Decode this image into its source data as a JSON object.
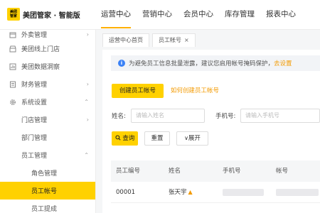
{
  "app": {
    "logo_badge_top": "美团",
    "logo_badge_bottom": "管家",
    "title": "美团管家 · 智能版"
  },
  "nav": [
    "运营中心",
    "营销中心",
    "会员中心",
    "库存管理",
    "报表中心"
  ],
  "sidebar": {
    "items": [
      {
        "label": "外卖管理",
        "icon": "takeout-icon"
      },
      {
        "label": "美团线上门店",
        "icon": "store-icon"
      },
      {
        "label": "美团数据洞察",
        "icon": "data-icon"
      },
      {
        "label": "财务管理",
        "icon": "finance-icon"
      },
      {
        "label": "系统设置",
        "icon": "gear-icon"
      },
      {
        "label": "门店管理"
      },
      {
        "label": "部门管理"
      },
      {
        "label": "员工管理"
      },
      {
        "label": "角色管理"
      },
      {
        "label": "员工帐号"
      },
      {
        "label": "员工提成"
      }
    ]
  },
  "tabs": [
    {
      "label": "运营中心首页"
    },
    {
      "label": "员工帐号",
      "close": "×"
    }
  ],
  "notice": {
    "text": "为避免员工信息批量泄露，建议您启用帐号掩码保护，",
    "link": "去设置"
  },
  "actions": {
    "create": "创建员工帐号",
    "how_to": "如何创建员工帐号"
  },
  "filters": {
    "name_label": "姓名:",
    "name_placeholder": "请输入姓名",
    "phone_label": "手机号:",
    "phone_placeholder": "请输入手机号"
  },
  "buttons": {
    "query": "查询",
    "reset": "重置",
    "expand": "展开"
  },
  "table": {
    "columns": [
      "员工编号",
      "姓名",
      "手机号",
      "帐号"
    ],
    "rows": [
      {
        "id": "00001",
        "name": "张天宇"
      }
    ]
  },
  "colors": {
    "accent": "#ffd100",
    "link": "#f39a00",
    "info": "#3b82f6"
  }
}
